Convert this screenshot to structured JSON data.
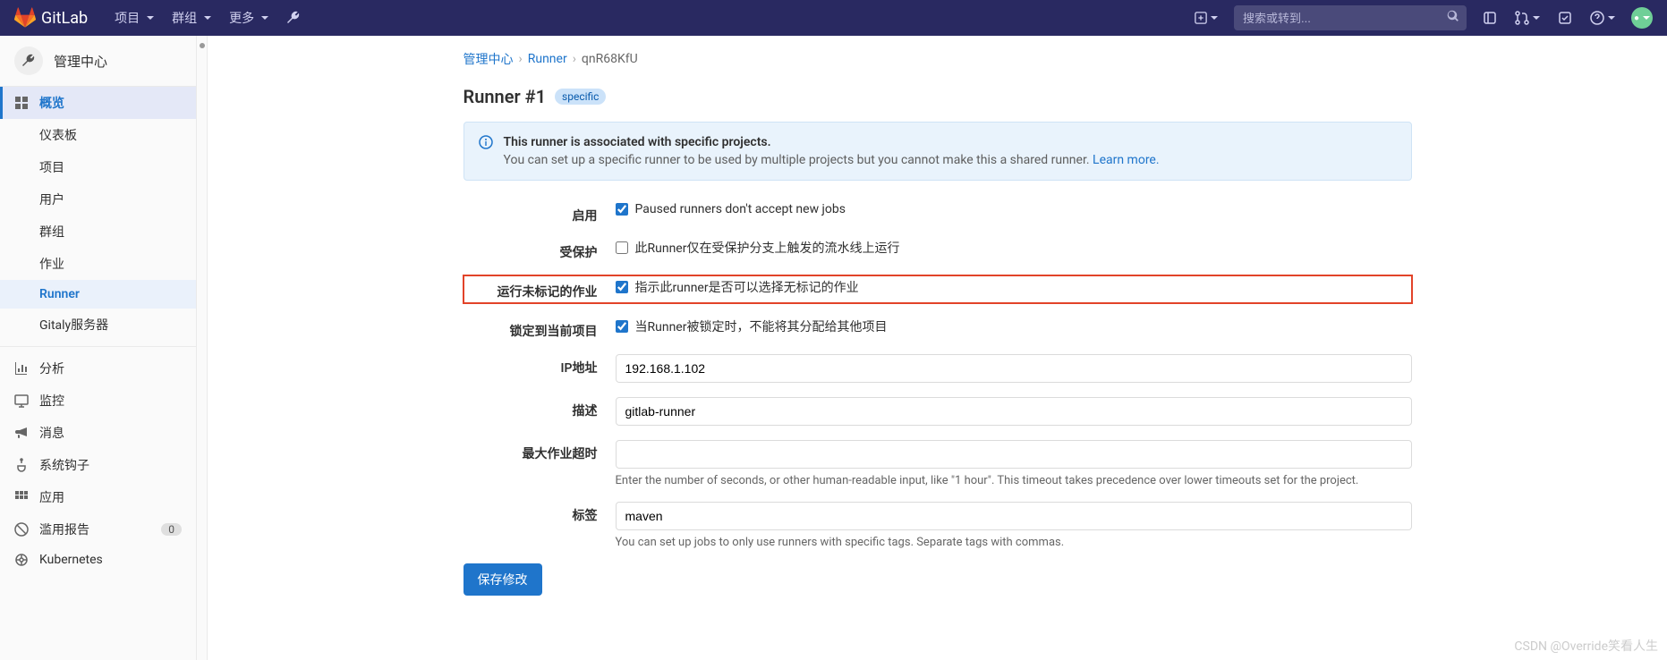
{
  "topnav": {
    "brand": "GitLab",
    "menu": {
      "projects": "项目",
      "groups": "群组",
      "more": "更多"
    },
    "search_placeholder": "搜索或转到..."
  },
  "sidebar": {
    "head": "管理中心",
    "overview": {
      "label": "概览",
      "items": [
        "仪表板",
        "项目",
        "用户",
        "群组",
        "作业",
        "Runner",
        "Gitaly服务器"
      ],
      "active_index": 5
    },
    "items": [
      {
        "label": "分析"
      },
      {
        "label": "监控"
      },
      {
        "label": "消息"
      },
      {
        "label": "系统钩子"
      },
      {
        "label": "应用"
      },
      {
        "label": "滥用报告",
        "badge": "0"
      },
      {
        "label": "Kubernetes"
      }
    ]
  },
  "breadcrumb": {
    "admin": "管理中心",
    "runner": "Runner",
    "current": "qnR68KfU"
  },
  "page": {
    "title": "Runner #1",
    "tag": "specific",
    "info_title": "This runner is associated with specific projects.",
    "info_desc": "You can set up a specific runner to be used by multiple projects but you cannot make this a shared runner. ",
    "info_link": "Learn more."
  },
  "form": {
    "enable": {
      "label": "启用",
      "check_label": "Paused runners don't accept new jobs",
      "checked": true
    },
    "protected": {
      "label": "受保护",
      "check_label": "此Runner仅在受保护分支上触发的流水线上运行",
      "checked": false
    },
    "untagged": {
      "label": "运行未标记的作业",
      "check_label": "指示此runner是否可以选择无标记的作业",
      "checked": true
    },
    "locked": {
      "label": "锁定到当前项目",
      "check_label": "当Runner被锁定时，不能将其分配给其他项目",
      "checked": true
    },
    "ip": {
      "label": "IP地址",
      "value": "192.168.1.102"
    },
    "desc": {
      "label": "描述",
      "value": "gitlab-runner"
    },
    "timeout": {
      "label": "最大作业超时",
      "value": "",
      "hint": "Enter the number of seconds, or other human-readable input, like \"1 hour\". This timeout takes precedence over lower timeouts set for the project."
    },
    "tags": {
      "label": "标签",
      "value": "maven",
      "hint": "You can set up jobs to only use runners with specific tags. Separate tags with commas."
    },
    "save": "保存修改"
  },
  "watermark": "CSDN @Override笑看人生"
}
